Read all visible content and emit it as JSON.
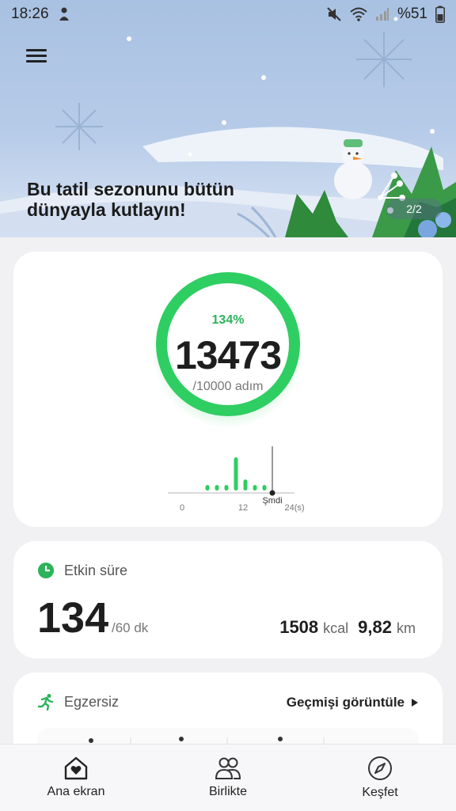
{
  "status_bar": {
    "time": "18:26",
    "battery": "%51"
  },
  "banner": {
    "headline_line1": "Bu tatil sezonunu bütün",
    "headline_line2": "dünyayla kutlayın!",
    "page_indicator": "2/2"
  },
  "steps": {
    "percent": "134%",
    "count": "13473",
    "goal": "/10000 adım",
    "chart_data": {
      "type": "bar",
      "x_ticks": [
        "0",
        "12",
        "24(s)"
      ],
      "now_label": "Şmdi",
      "values": [
        1,
        1,
        1,
        6,
        2,
        1,
        1
      ],
      "note_range": [
        0,
        24
      ]
    }
  },
  "active_time": {
    "title": "Etkin süre",
    "value": "134",
    "unit": "/60 dk",
    "kcal_value": "1508",
    "kcal_unit": "kcal",
    "km_value": "9,82",
    "km_unit": "km"
  },
  "exercise": {
    "title": "Egzersiz",
    "history_link": "Geçmişi görüntüle"
  },
  "bottom_nav": {
    "home": "Ana ekran",
    "together": "Birlikte",
    "discover": "Keşfet"
  },
  "colors": {
    "accent_green": "#2bb35a",
    "ring_green": "#2fce62"
  }
}
